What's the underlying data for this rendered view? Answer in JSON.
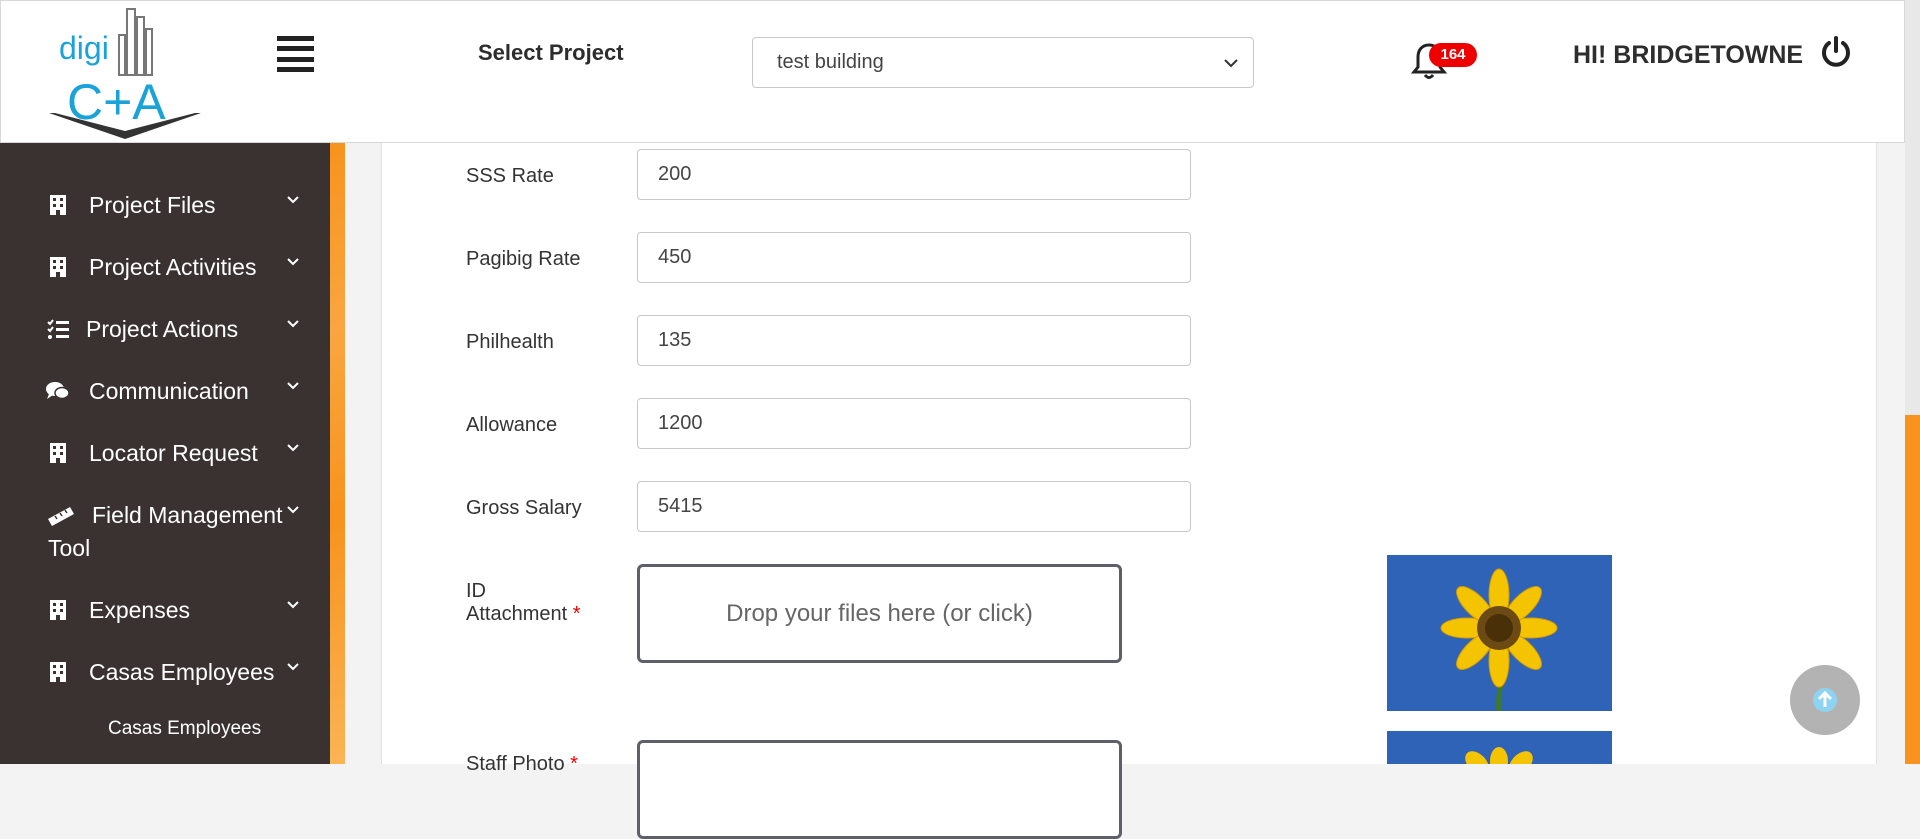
{
  "header": {
    "logo_text_top": "digi",
    "logo_text_bottom": "C+A",
    "select_label": "Select Project",
    "project_selected": "test building",
    "notification_count": "164",
    "greeting": "HI! BRIDGETOWNE"
  },
  "sidebar": {
    "items": [
      {
        "label": "Project Files",
        "icon": "building-icon"
      },
      {
        "label": "Project Activities",
        "icon": "building-icon"
      },
      {
        "label": "Project Actions",
        "icon": "tasks-icon"
      },
      {
        "label": "Communication",
        "icon": "comments-icon"
      },
      {
        "label": "Locator Request",
        "icon": "building-icon"
      },
      {
        "label": "Field Management",
        "label2": "Tool",
        "icon": "ruler-icon"
      },
      {
        "label": "Expenses",
        "icon": "building-icon"
      },
      {
        "label": "Casas Employees",
        "icon": "building-icon"
      }
    ],
    "subitem": "Casas Employees"
  },
  "form": {
    "fields": [
      {
        "label": "SSS Rate",
        "value": "200"
      },
      {
        "label": "Pagibig Rate",
        "value": "450"
      },
      {
        "label": "Philhealth",
        "value": "135"
      },
      {
        "label": "Allowance",
        "value": "1200"
      },
      {
        "label": "Gross Salary",
        "value": "5415"
      }
    ],
    "id_attachment_label_1": "ID",
    "id_attachment_label_2": "Attachment",
    "staff_photo_label": "Staff Photo",
    "required_mark": "*",
    "dropzone_text": "Drop your files here (or click)"
  },
  "colors": {
    "sidebar_bg": "#3a3230",
    "accent_orange": "#f7931e",
    "badge_red": "#ee0000",
    "logo_blue": "#1aa3d9"
  }
}
